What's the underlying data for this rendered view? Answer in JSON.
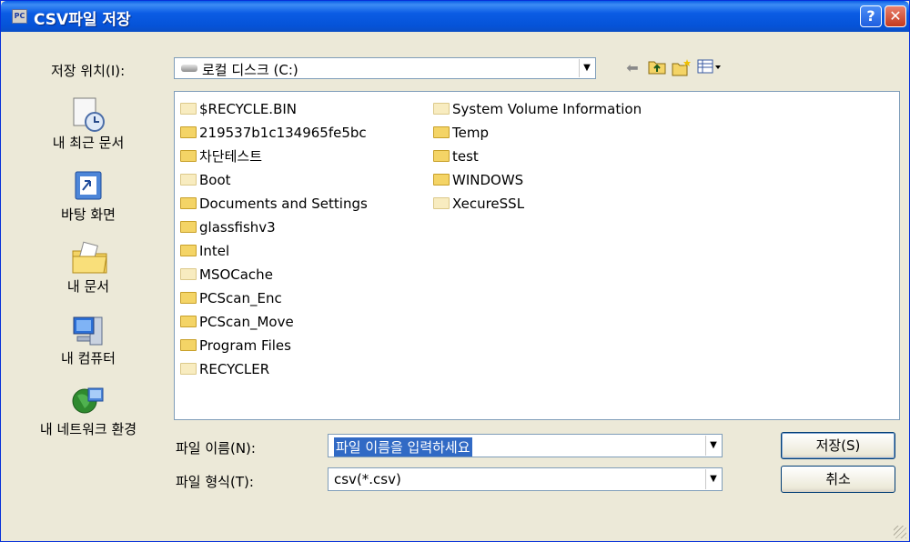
{
  "window": {
    "title": "CSV파일 저장",
    "title_icon_text": "PC",
    "help_label": "?",
    "close_label": "✕"
  },
  "save_in": {
    "label": "저장 위치(I):",
    "value": "로컬 디스크 (C:)"
  },
  "places": [
    {
      "label": "내 최근 문서",
      "icon": "recent-documents-icon"
    },
    {
      "label": "바탕 화면",
      "icon": "desktop-icon"
    },
    {
      "label": "내 문서",
      "icon": "my-documents-icon"
    },
    {
      "label": "내 컴퓨터",
      "icon": "my-computer-icon"
    },
    {
      "label": "내 네트워크 환경",
      "icon": "network-places-icon"
    }
  ],
  "files": {
    "col1": [
      "$RECYCLE.BIN",
      "219537b1c134965fe5bc",
      "차단테스트",
      "Boot",
      "Documents and Settings",
      "glassfishv3",
      "Intel",
      "MSOCache",
      "PCScan_Enc",
      "PCScan_Move",
      "Program Files",
      "RECYCLER"
    ],
    "col2": [
      "System Volume Information",
      "Temp",
      "test",
      "WINDOWS",
      "XecureSSL"
    ]
  },
  "filename": {
    "label": "파일 이름(N):",
    "value": "파일 이름을 입력하세요"
  },
  "filetype": {
    "label": "파일 형식(T):",
    "value": "csv(*.csv)"
  },
  "buttons": {
    "save": "저장(S)",
    "cancel": "취소"
  },
  "colors": {
    "titlebar": "#0553d8",
    "selection": "#316ac5",
    "dialog_bg": "#ece9d8"
  }
}
